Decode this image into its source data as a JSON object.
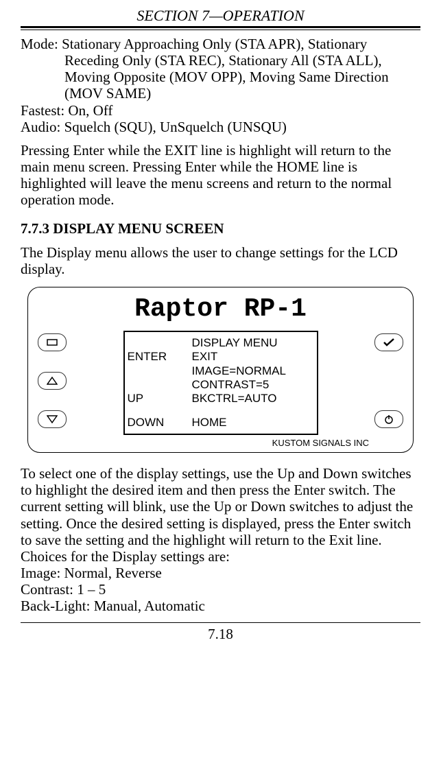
{
  "header": {
    "section_title": "SECTION 7—OPERATION"
  },
  "top_block": {
    "mode_line": "Mode: Stationary Approaching Only (STA APR), Stationary Receding Only (STA REC), Stationary All (STA ALL), Moving Opposite (MOV OPP), Moving Same Direction (MOV SAME)",
    "fastest_line": "Fastest: On, Off",
    "audio_line": "Audio: Squelch (SQU), UnSquelch (UNSQU)",
    "exit_para": "Pressing Enter while the EXIT line is highlight will return to the main menu screen.  Pressing Enter while the HOME line is highlighted will leave the menu screens and return to the normal operation mode."
  },
  "section773": {
    "heading": "7.7.3 DISPLAY MENU SCREEN",
    "intro": "The Display menu allows the user to change settings for the LCD display."
  },
  "device": {
    "title": "Raptor RP-1",
    "lcd": {
      "r1c2": "DISPLAY MENU",
      "r2c1": "ENTER",
      "r2c2": "EXIT",
      "r3c2": "IMAGE=NORMAL",
      "r4c2": "CONTRAST=5",
      "r5c1": "UP",
      "r5c2": "BKCTRL=AUTO",
      "r6c1": "DOWN",
      "r6c2": "HOME"
    },
    "brand": "KUSTOM SIGNALS INC"
  },
  "bottom_block": {
    "para": "To select one of the display settings, use the Up and Down switches to highlight the desired item and then press the Enter switch.  The current setting will blink, use the Up or Down switches to adjust the setting.  Once the desired setting is displayed, press the Enter switch to save the setting and the highlight will return to the Exit line.",
    "choices_label": "Choices for the Display settings are:",
    "image_line": "Image: Normal, Reverse",
    "contrast_line": "Contrast: 1 – 5",
    "backlight_line": "Back-Light: Manual, Automatic"
  },
  "footer": {
    "page_number": "7.18"
  }
}
